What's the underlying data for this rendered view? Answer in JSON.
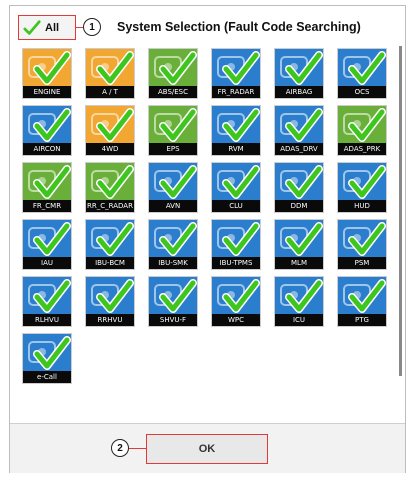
{
  "header": {
    "all_label": "All",
    "title": "System Selection (Fault Code Searching)",
    "callout_1": "1"
  },
  "footer": {
    "ok_label": "OK",
    "callout_2": "2"
  },
  "colors": {
    "tile_blue": "#1a73c9",
    "tile_orange": "#f0a020",
    "tile_green": "#5fa92b",
    "check_green": "#3ec51e",
    "highlight_red": "#e23a3a"
  },
  "systems": [
    {
      "label": "ENGINE",
      "color": "orange",
      "icon": "engine-icon",
      "checked": true
    },
    {
      "label": "A / T",
      "color": "orange",
      "icon": "gear-icon",
      "checked": true
    },
    {
      "label": "ABS/ESC",
      "color": "green",
      "icon": "abs-icon",
      "checked": true
    },
    {
      "label": "FR_RADAR",
      "color": "blue",
      "icon": "radar-icon",
      "checked": true
    },
    {
      "label": "AIRBAG",
      "color": "blue",
      "icon": "airbag-icon",
      "checked": true
    },
    {
      "label": "OCS",
      "color": "blue",
      "icon": "seat-icon",
      "checked": true
    },
    {
      "label": "AIRCON",
      "color": "blue",
      "icon": "aircon-icon",
      "checked": true
    },
    {
      "label": "4WD",
      "color": "orange",
      "icon": "drivetrain-icon",
      "checked": true
    },
    {
      "label": "EPS",
      "color": "green",
      "icon": "steering-icon",
      "checked": true
    },
    {
      "label": "RVM",
      "color": "blue",
      "icon": "camera-icon",
      "checked": true
    },
    {
      "label": "ADAS_DRV",
      "color": "blue",
      "icon": "adas-drive-icon",
      "checked": true
    },
    {
      "label": "ADAS_PRK",
      "color": "green",
      "icon": "parking-icon",
      "checked": true
    },
    {
      "label": "FR_CMR",
      "color": "green",
      "icon": "front-camera-icon",
      "checked": true
    },
    {
      "label": "RR_C_RADAR",
      "color": "green",
      "icon": "rear-radar-icon",
      "checked": true
    },
    {
      "label": "AVN",
      "color": "blue",
      "icon": "avn-icon",
      "checked": true
    },
    {
      "label": "CLU",
      "color": "blue",
      "icon": "cluster-icon",
      "checked": true
    },
    {
      "label": "DDM",
      "color": "blue",
      "icon": "door-icon",
      "checked": true
    },
    {
      "label": "HUD",
      "color": "blue",
      "icon": "hud-icon",
      "checked": true
    },
    {
      "label": "IAU",
      "color": "blue",
      "icon": "iau-icon",
      "checked": true
    },
    {
      "label": "IBU-BCM",
      "color": "blue",
      "icon": "bcm-icon",
      "checked": true
    },
    {
      "label": "IBU-SMK",
      "color": "blue",
      "icon": "smartkey-icon",
      "checked": true
    },
    {
      "label": "IBU-TPMS",
      "color": "blue",
      "icon": "tpms-icon",
      "checked": true
    },
    {
      "label": "MLM",
      "color": "blue",
      "icon": "mlm-icon",
      "checked": true
    },
    {
      "label": "PSM",
      "color": "blue",
      "icon": "psm-icon",
      "checked": true
    },
    {
      "label": "RLHVU",
      "color": "blue",
      "icon": "rlhvu-icon",
      "checked": true
    },
    {
      "label": "RRHVU",
      "color": "blue",
      "icon": "rrhvu-icon",
      "checked": true
    },
    {
      "label": "SHVU-F",
      "color": "blue",
      "icon": "shvu-icon",
      "checked": true
    },
    {
      "label": "WPC",
      "color": "blue",
      "icon": "wireless-charger-icon",
      "checked": true
    },
    {
      "label": "ICU",
      "color": "blue",
      "icon": "icu-icon",
      "checked": true
    },
    {
      "label": "PTG",
      "color": "blue",
      "icon": "tailgate-icon",
      "checked": true
    },
    {
      "label": "e-Call",
      "color": "blue",
      "icon": "ecall-icon",
      "checked": true
    }
  ]
}
